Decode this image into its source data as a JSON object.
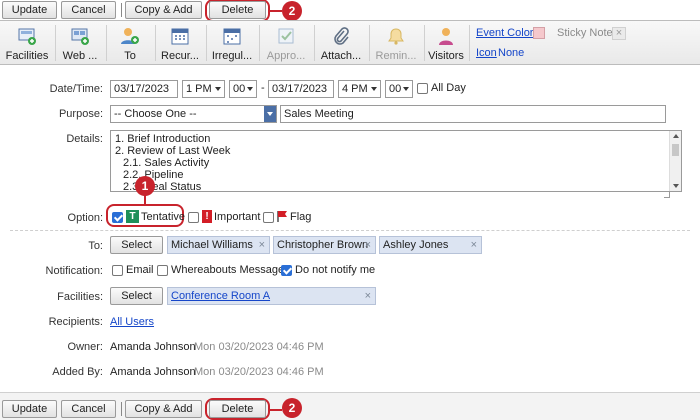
{
  "top_actions": {
    "update": "Update",
    "cancel": "Cancel",
    "copy_add": "Copy & Add",
    "delete": "Delete",
    "callout": "2"
  },
  "toolbar": {
    "facilities": "Facilities",
    "web": "Web ...",
    "to": "To",
    "recurring": "Recur...",
    "irregular": "Irregul...",
    "approval": "Appro...",
    "attach": "Attach...",
    "reminder": "Remin...",
    "visitors": "Visitors",
    "event_color_label": "Event Color",
    "event_color_value": "#f5c8cc",
    "sticky_note": "Sticky Note",
    "sticky_x": "×",
    "icon_label": "Icon",
    "icon_value": "None"
  },
  "form": {
    "datetime_label": "Date/Time:",
    "start_date": "03/17/2023",
    "start_hour": "1 PM",
    "start_min": "00",
    "range_dash": "-",
    "end_date": "03/17/2023",
    "end_hour": "4 PM",
    "end_min": "00",
    "all_day": "All Day",
    "purpose_label": "Purpose:",
    "purpose_select": "-- Choose One --",
    "purpose_value": "Sales Meeting",
    "details_label": "Details:",
    "details_lines": [
      "1. Brief Introduction",
      "2. Review of Last Week",
      "2.1. Sales Activity",
      "2.2. Pipeline",
      "2.3. Deal Status"
    ],
    "option_label": "Option:",
    "tentative_icon": "T",
    "tentative": "Tentative",
    "important_icon": "!",
    "important": "Important",
    "flag": "Flag",
    "option_callout": "1",
    "to_label": "To:",
    "select_label": "Select",
    "to_users": [
      "Michael Williams",
      "Christopher Brown",
      "Ashley Jones"
    ],
    "chip_x": "×",
    "notification_label": "Notification:",
    "notif_email": "Email",
    "notif_whereabouts": "Whereabouts Message",
    "notif_donot": "Do not notify me",
    "facilities_label": "Facilities:",
    "facility": "Conference Room A",
    "recipients_label": "Recipients:",
    "recipients_value": "All Users",
    "owner_label": "Owner:",
    "owner_name": "Amanda Johnson",
    "owner_time": "Mon 03/20/2023 04:46 PM",
    "addedby_label": "Added By:",
    "addedby_name": "Amanda Johnson",
    "addedby_time": "Mon 03/20/2023 04:46 PM"
  },
  "bottom_actions": {
    "update": "Update",
    "cancel": "Cancel",
    "copy_add": "Copy & Add",
    "delete": "Delete",
    "callout": "2"
  }
}
